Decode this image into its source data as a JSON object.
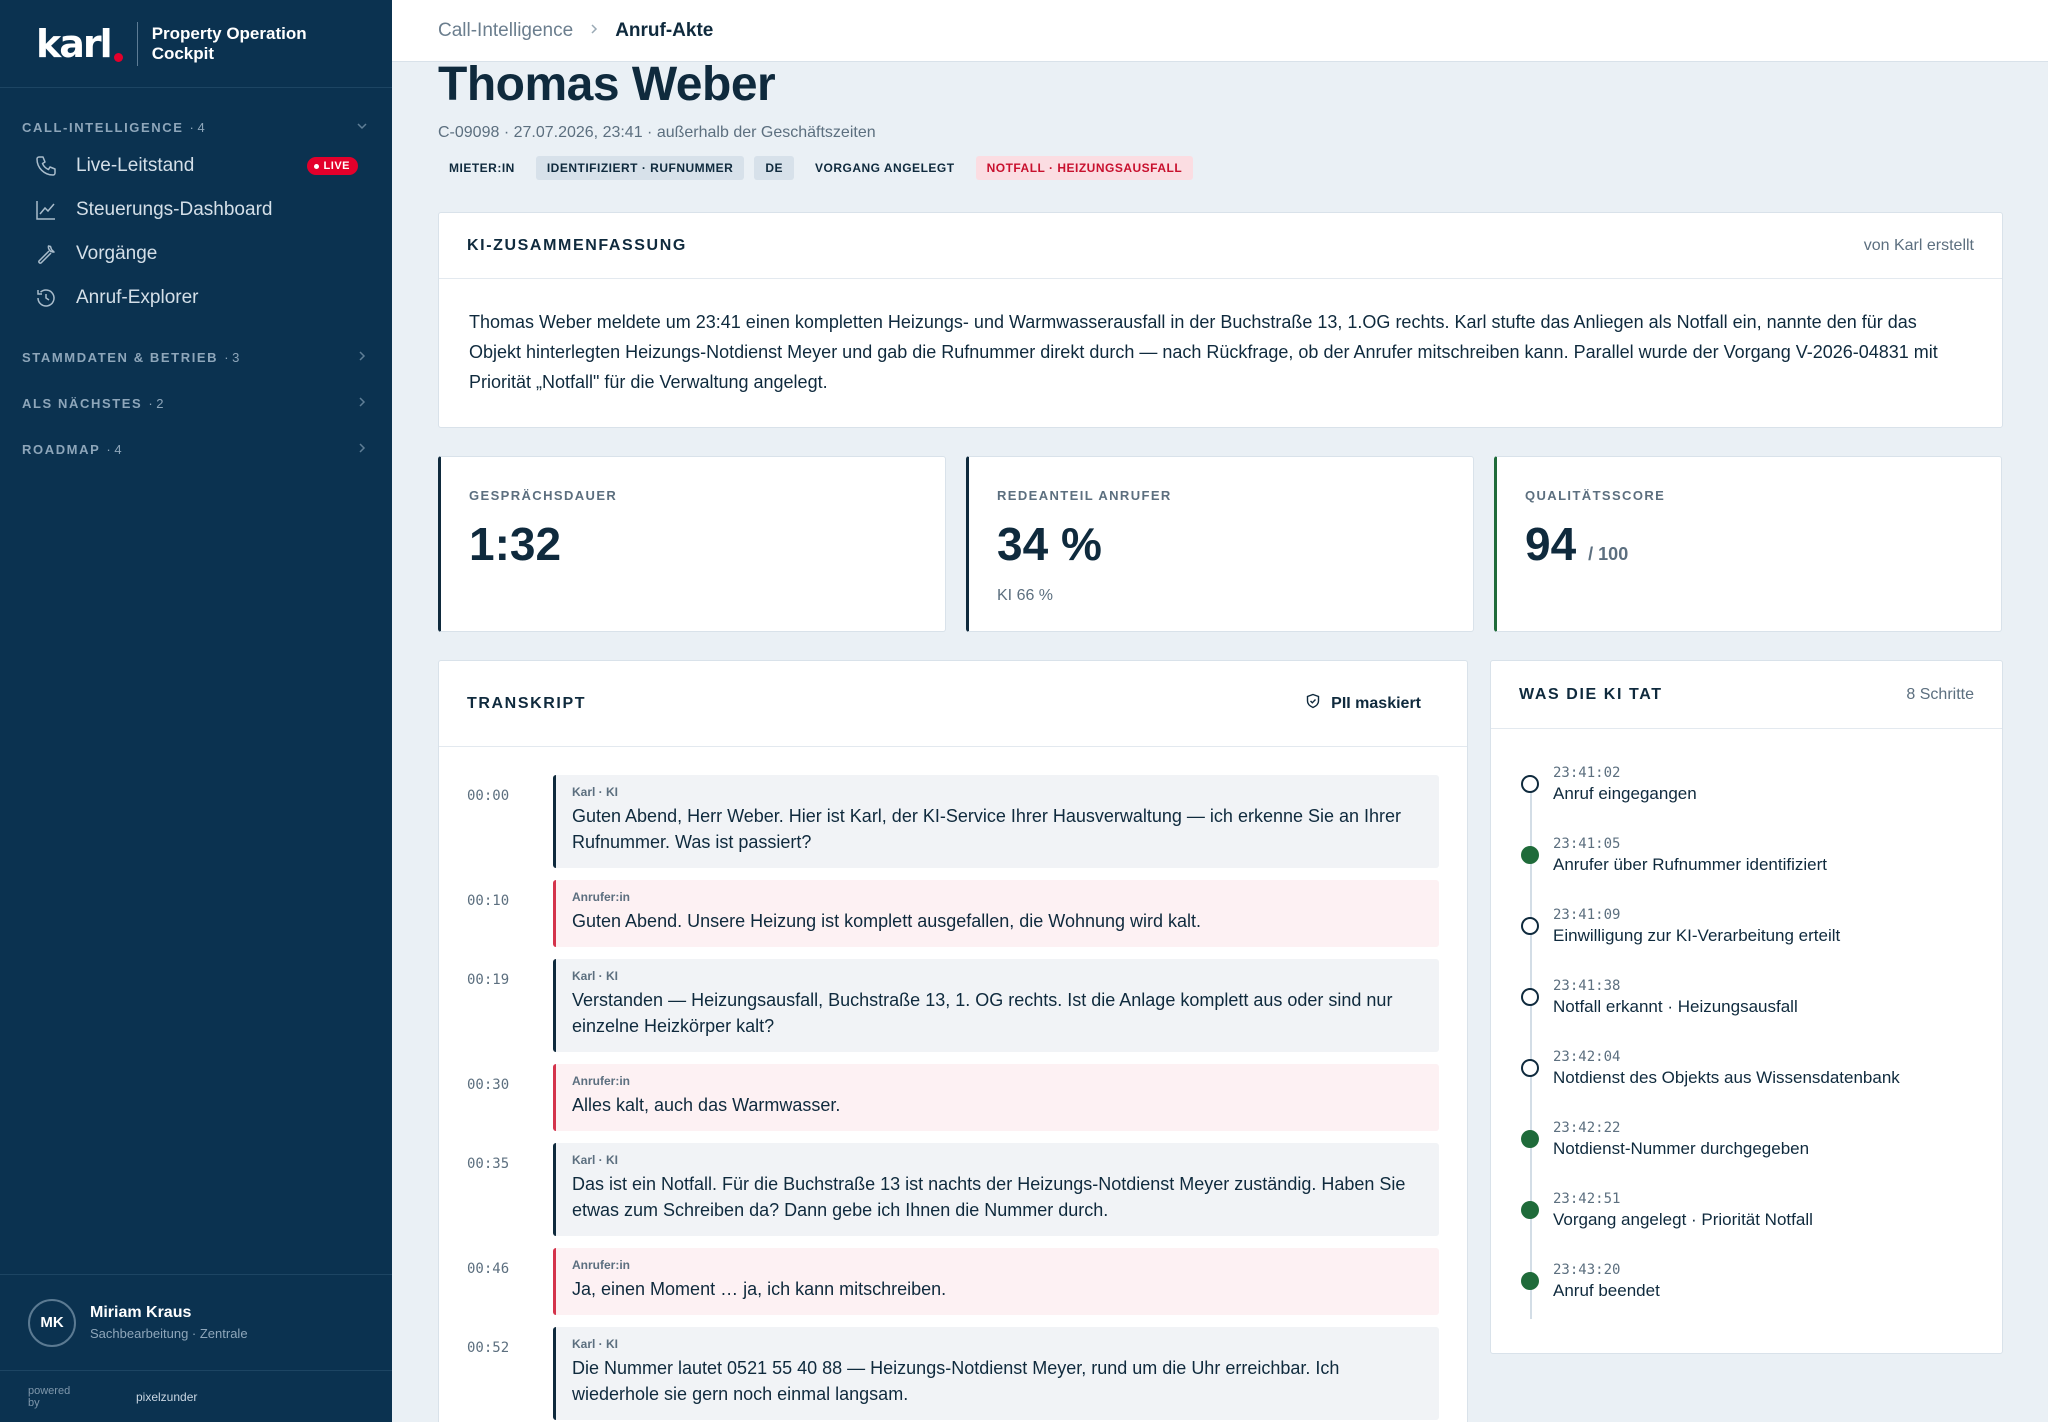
{
  "brand": {
    "logo": "karl",
    "subtitle_line1": "Property Operation",
    "subtitle_line2": "Cockpit"
  },
  "sidebar": {
    "sections": [
      {
        "label": "CALL-INTELLIGENCE",
        "count": "· 4",
        "expanded": true
      },
      {
        "label": "STAMMDATEN & BETRIEB",
        "count": "· 3",
        "expanded": false
      },
      {
        "label": "ALS NÄCHSTES",
        "count": "· 2",
        "expanded": false
      },
      {
        "label": "ROADMAP",
        "count": "· 4",
        "expanded": false
      }
    ],
    "items": [
      {
        "label": "Live-Leitstand",
        "icon": "phone-icon",
        "badge": "LIVE"
      },
      {
        "label": "Steuerungs-Dashboard",
        "icon": "chart-icon"
      },
      {
        "label": "Vorgänge",
        "icon": "wrench-icon"
      },
      {
        "label": "Anruf-Explorer",
        "icon": "history-icon"
      }
    ],
    "user": {
      "initials": "MK",
      "name": "Miriam Kraus",
      "role": "Sachbearbeitung · Zentrale"
    },
    "powered_by": "powered by",
    "powered_name": "pixelzunder"
  },
  "breadcrumb": {
    "parent": "Call-Intelligence",
    "current": "Anruf-Akte"
  },
  "header": {
    "title": "Thomas Weber",
    "meta": "C-09098 · 27.07.2026, 23:41 · außerhalb der Geschäftszeiten",
    "tags": [
      "MIETER:IN",
      "IDENTIFIZIERT · RUFNUMMER",
      "DE",
      "VORGANG ANGELEGT",
      "NOTFALL · HEIZUNGSAUSFALL"
    ]
  },
  "summary": {
    "title": "KI-ZUSAMMENFASSUNG",
    "aside": "von Karl erstellt",
    "text": "Thomas Weber meldete um 23:41 einen kompletten Heizungs- und Warmwasserausfall in der Buchstraße 13, 1.OG rechts. Karl stufte das Anliegen als Notfall ein, nannte den für das Objekt hinterlegten Heizungs-Notdienst Meyer und gab die Rufnummer direkt durch — nach Rückfrage, ob der Anrufer mitschreiben kann. Parallel wurde der Vorgang V-2026-04831 mit Priorität „Notfall\" für die Verwaltung angelegt."
  },
  "kpis": [
    {
      "label": "GESPRÄCHSDAUER",
      "value": "1:32",
      "suffix": "",
      "sub": ""
    },
    {
      "label": "REDEANTEIL ANRUFER",
      "value": "34 %",
      "suffix": "",
      "sub": "KI 66 %"
    },
    {
      "label": "QUALITÄTSSCORE",
      "value": "94",
      "suffix": "/ 100",
      "sub": ""
    }
  ],
  "transcript": {
    "title": "TRANSKRIPT",
    "pii_label": "PII maskiert",
    "messages": [
      {
        "time": "00:00",
        "speaker": "Karl · KI",
        "role": "ai",
        "text": "Guten Abend, Herr Weber. Hier ist Karl, der KI-Service Ihrer Hausverwaltung — ich erkenne Sie an Ihrer Rufnummer. Was ist passiert?"
      },
      {
        "time": "00:10",
        "speaker": "Anrufer:in",
        "role": "caller",
        "text": "Guten Abend. Unsere Heizung ist komplett ausgefallen, die Wohnung wird kalt."
      },
      {
        "time": "00:19",
        "speaker": "Karl · KI",
        "role": "ai",
        "text": "Verstanden — Heizungsausfall, Buchstraße 13, 1. OG rechts. Ist die Anlage komplett aus oder sind nur einzelne Heizkörper kalt?"
      },
      {
        "time": "00:30",
        "speaker": "Anrufer:in",
        "role": "caller",
        "text": "Alles kalt, auch das Warmwasser."
      },
      {
        "time": "00:35",
        "speaker": "Karl · KI",
        "role": "ai",
        "text": "Das ist ein Notfall. Für die Buchstraße 13 ist nachts der Heizungs-Notdienst Meyer zuständig. Haben Sie etwas zum Schreiben da? Dann gebe ich Ihnen die Nummer durch."
      },
      {
        "time": "00:46",
        "speaker": "Anrufer:in",
        "role": "caller",
        "text": "Ja, einen Moment … ja, ich kann mitschreiben."
      },
      {
        "time": "00:52",
        "speaker": "Karl · KI",
        "role": "ai",
        "text": "Die Nummer lautet 0521 55 40 88 — Heizungs-Notdienst Meyer, rund um die Uhr erreichbar. Ich wiederhole sie gern noch einmal langsam."
      }
    ]
  },
  "steps": {
    "title": "WAS DIE KI TAT",
    "aside": "8 Schritte",
    "items": [
      {
        "time": "23:41:02",
        "label": "Anruf eingegangen",
        "done": false
      },
      {
        "time": "23:41:05",
        "label": "Anrufer über Rufnummer identifiziert",
        "done": true
      },
      {
        "time": "23:41:09",
        "label": "Einwilligung zur KI-Verarbeitung erteilt",
        "done": false
      },
      {
        "time": "23:41:38",
        "label": "Notfall erkannt · Heizungsausfall",
        "done": false
      },
      {
        "time": "23:42:04",
        "label": "Notdienst des Objekts aus Wissensdatenbank",
        "done": false
      },
      {
        "time": "23:42:22",
        "label": "Notdienst-Nummer durchgegeben",
        "done": true
      },
      {
        "time": "23:42:51",
        "label": "Vorgang angelegt · Priorität Notfall",
        "done": true
      },
      {
        "time": "23:43:20",
        "label": "Anruf beendet",
        "done": true
      }
    ]
  },
  "colors": {
    "sidebar": "#0b3250",
    "accent_red": "#e3002b",
    "success_green": "#1f6b3a",
    "text_dark": "#0f2a3d"
  }
}
